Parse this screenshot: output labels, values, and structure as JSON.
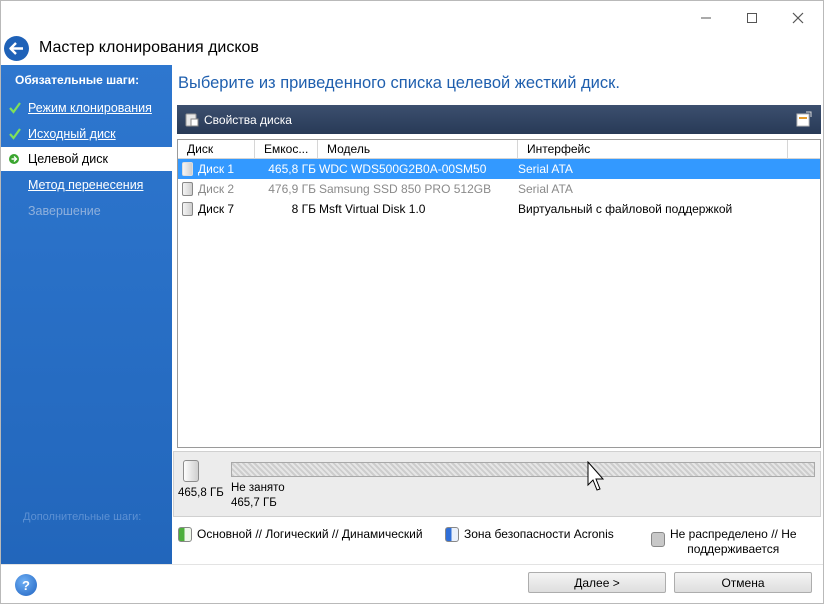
{
  "window": {
    "minimize_glyph": "—",
    "maximize_glyph": "☐",
    "close_glyph": "✕"
  },
  "header": {
    "title": "Мастер клонирования дисков"
  },
  "sidebar": {
    "heading": "Обязательные шаги:",
    "items": [
      {
        "label": "Режим клонирования",
        "state": "done"
      },
      {
        "label": "Исходный диск",
        "state": "done"
      },
      {
        "label": "Целевой диск",
        "state": "current"
      },
      {
        "label": "Метод перенесения",
        "state": "pending"
      },
      {
        "label": "Завершение",
        "state": "disabled"
      }
    ],
    "footer": "Дополнительные шаги:"
  },
  "main": {
    "instruction": "Выберите из приведенного списка целевой жесткий диск.",
    "toolbar": {
      "properties_label": "Свойства диска"
    },
    "table": {
      "columns": [
        "Диск",
        "Емкос...",
        "Модель",
        "Интерфейс"
      ],
      "rows": [
        {
          "disk": "Диск 1",
          "capacity": "465,8 ГБ",
          "model": "WDC WDS500G2B0A-00SM50",
          "interface": "Serial ATA",
          "state": "selected"
        },
        {
          "disk": "Диск 2",
          "capacity": "476,9 ГБ",
          "model": "Samsung SSD 850 PRO 512GB",
          "interface": "Serial ATA",
          "state": "dimmed"
        },
        {
          "disk": "Диск 7",
          "capacity": "8 ГБ",
          "model": "Msft Virtual Disk 1.0",
          "interface": "Виртуальный с файловой поддержкой",
          "state": "normal"
        }
      ]
    },
    "disk_map": {
      "disk_size": "465,8 ГБ",
      "partition_label": "Не занято",
      "partition_size": "465,7 ГБ"
    },
    "legend": {
      "primary": "Основной // Логический // Динамический",
      "acronis": "Зона безопасности Acronis",
      "unallocated_line1": "Не распределено // Не",
      "unallocated_line2": "поддерживается"
    }
  },
  "footer": {
    "help_label": "?",
    "next_label": "Далее >",
    "cancel_label": "Отмена"
  },
  "colors": {
    "sidebar": "#2a70c7",
    "accent_text": "#1f5fae",
    "selection": "#3399ff",
    "toolbar": "#2f4263",
    "legend_primary": "#58b947",
    "legend_acronis": "#2f6fd8",
    "legend_unallocated": "#c8c8c8"
  }
}
